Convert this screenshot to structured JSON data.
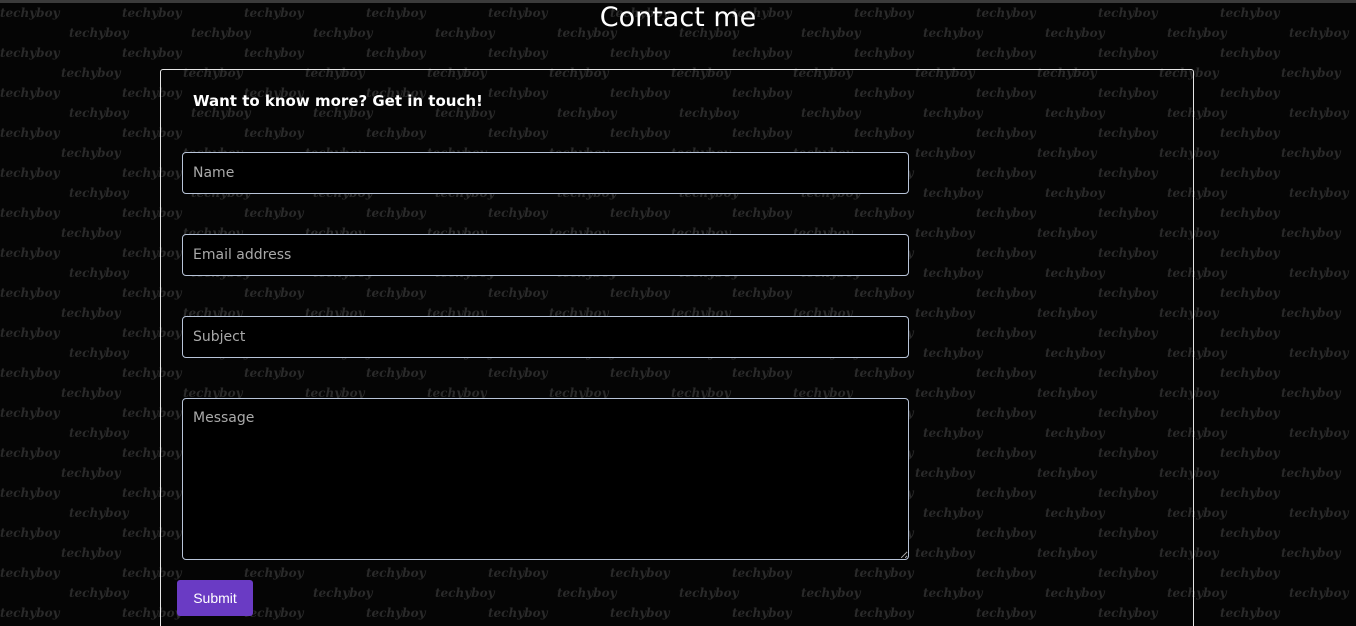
{
  "page": {
    "title": "Contact me"
  },
  "background": {
    "watermark_text": "techyboy",
    "color": "#050505"
  },
  "contact_form": {
    "heading": "Want to know more? Get in touch!",
    "name_placeholder": "Name",
    "email_placeholder": "Email address",
    "subject_placeholder": "Subject",
    "message_placeholder": "Message",
    "submit_label": "Submit"
  },
  "colors": {
    "accent": "#6a3bc4",
    "field_border": "#b8c4d8",
    "card_border": "#e6e6e6"
  }
}
